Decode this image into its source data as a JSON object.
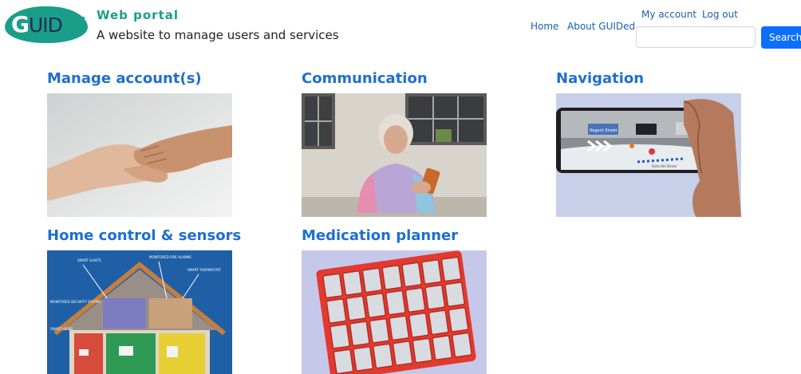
{
  "header": {
    "logo_text": "GUIDed",
    "site_name": "Web portal",
    "tagline": "A website to manage users and services"
  },
  "nav": {
    "home": "Home",
    "about": "About GUIDed",
    "my_account": "My account",
    "log_out": "Log out"
  },
  "search": {
    "value": "",
    "placeholder": "",
    "button_label": "Search"
  },
  "tiles": [
    {
      "title": "Manage account(s)"
    },
    {
      "title": "Communication"
    },
    {
      "title": "Navigation"
    },
    {
      "title": "Home control & sensors"
    },
    {
      "title": "Medication planner"
    }
  ],
  "images": {
    "navigation": {
      "sign_text": "Regent Street",
      "route_text": "Soho Hill Street"
    }
  },
  "colors": {
    "accent": "#1a9e8a",
    "link": "#1a5fa8",
    "tile_title": "#1e6fcf",
    "search_button": "#0d6efd"
  }
}
